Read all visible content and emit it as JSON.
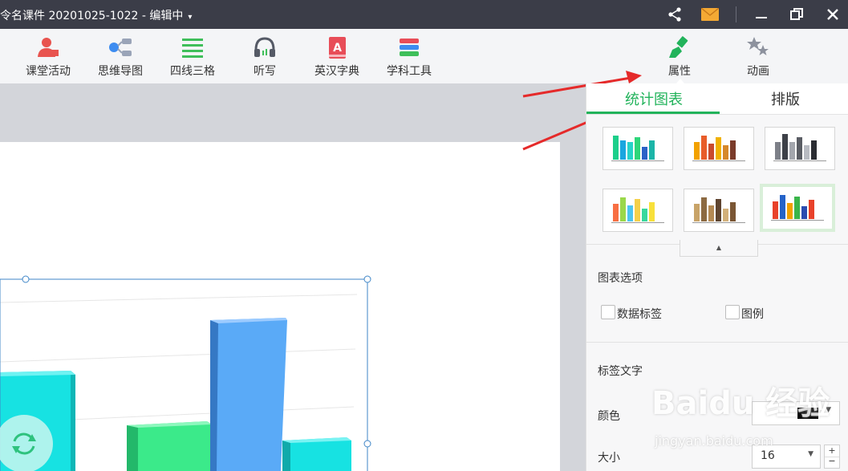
{
  "titlebar": {
    "title": "令名课件 20201025-1022 - 编辑中",
    "dropdown_glyph": "▾",
    "icons": [
      "share-icon",
      "mail-icon",
      "minimize-icon",
      "restore-icon",
      "close-icon"
    ]
  },
  "toolbar": {
    "items": [
      {
        "label": "课堂活动",
        "icon": "classroom-activity-icon"
      },
      {
        "label": "思维导图",
        "icon": "mind-map-icon"
      },
      {
        "label": "四线三格",
        "icon": "four-line-grid-icon"
      },
      {
        "label": "听写",
        "icon": "dictation-headphones-icon"
      },
      {
        "label": "英汉字典",
        "icon": "dictionary-icon"
      },
      {
        "label": "学科工具",
        "icon": "subject-tools-icon"
      }
    ],
    "right_items": [
      {
        "label": "属性",
        "icon": "brush-icon"
      },
      {
        "label": "动画",
        "icon": "stars-icon"
      }
    ]
  },
  "panel": {
    "tabs": [
      {
        "label": "统计图表",
        "active": true
      },
      {
        "label": "排版",
        "active": false
      }
    ],
    "styles_selected_index": 5,
    "chart_options_title": "图表选项",
    "option_data_labels": "数据标签",
    "option_legend": "图例",
    "label_text_title": "标签文字",
    "color_label": "颜色",
    "color_value": "#000000",
    "size_label": "大小",
    "size_value": "16",
    "accent": "#22b35b"
  },
  "watermark": {
    "line1": "Baidu 经验",
    "line2": "jingyan.baidu.com"
  }
}
